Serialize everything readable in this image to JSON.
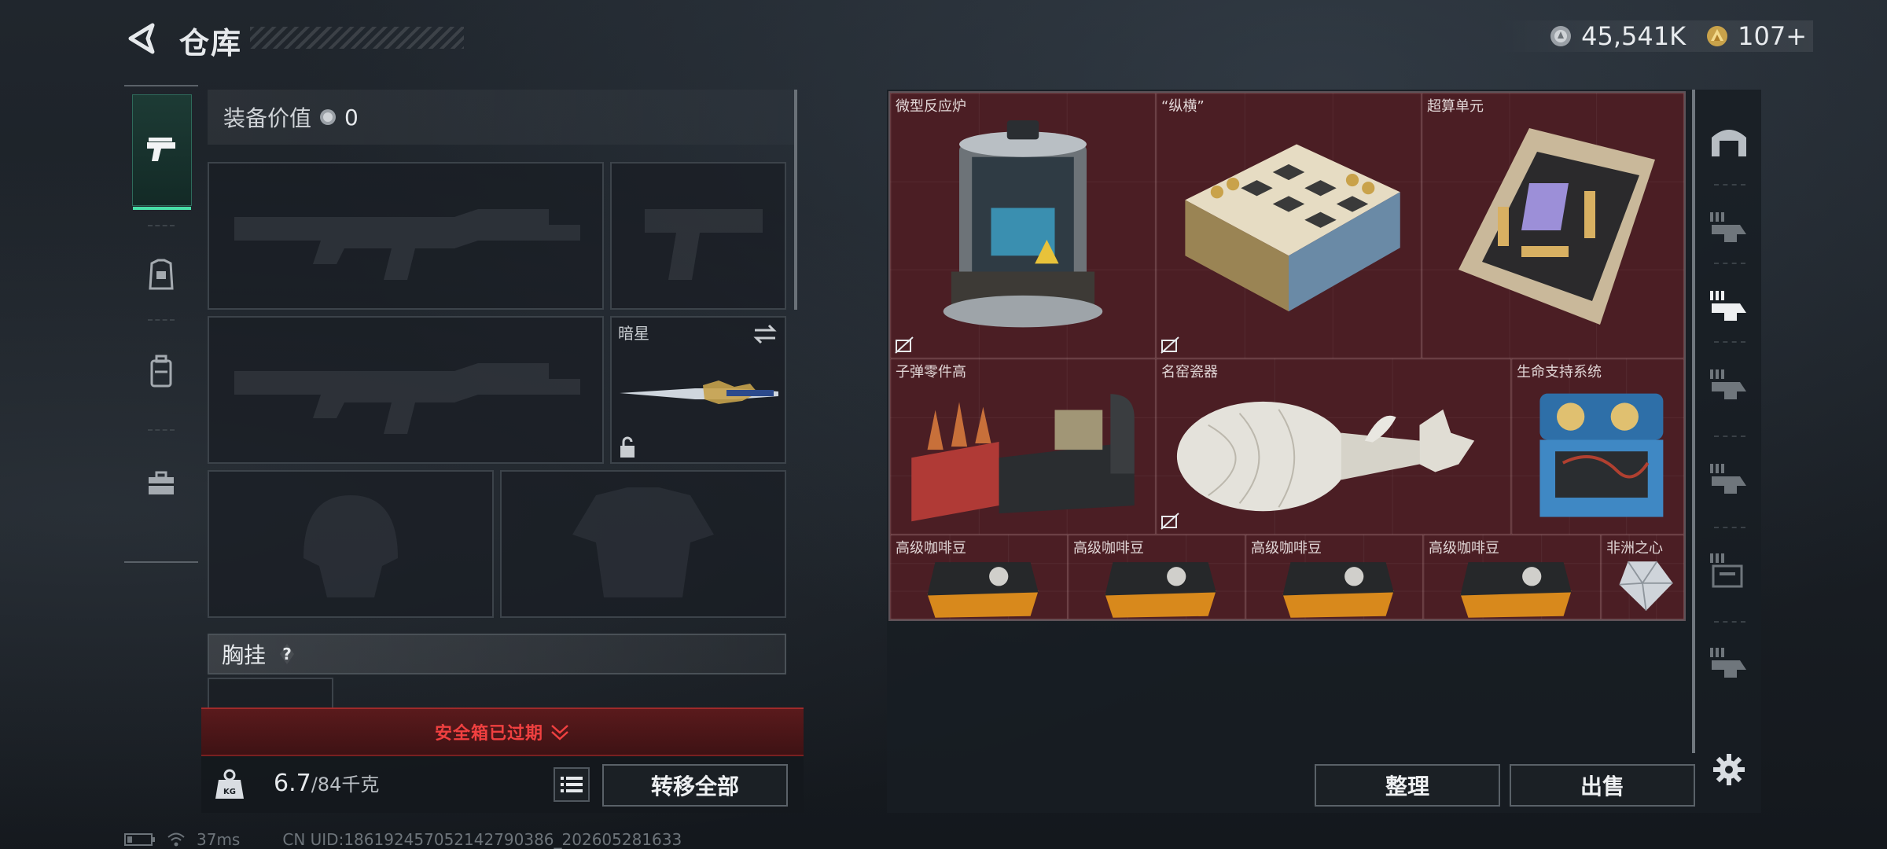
{
  "header": {
    "title": "仓库"
  },
  "currency": {
    "silver": "45,541K",
    "gold": "107+"
  },
  "nav": {
    "items": [
      "weapon-tab",
      "armor-tab",
      "backpack-tab",
      "case-tab"
    ]
  },
  "loadout": {
    "equip_label": "装备价值",
    "equip_value": "0",
    "melee_label": "暗星",
    "chest_label": "胸挂",
    "safe_box_status": "安全箱已过期",
    "weight_current": "6.7",
    "weight_max": "/84千克",
    "transfer_all": "转移全部"
  },
  "storage": {
    "items": [
      {
        "name": "微型反应炉"
      },
      {
        "name": "“纵横”"
      },
      {
        "name": "超算单元"
      },
      {
        "name": "子弹零件高"
      },
      {
        "name": "名窑瓷器"
      },
      {
        "name": "生命支持系统"
      },
      {
        "name": "高级咖啡豆"
      },
      {
        "name": "高级咖啡豆"
      },
      {
        "name": "高级咖啡豆"
      },
      {
        "name": "高级咖啡豆"
      },
      {
        "name": "非洲之心"
      }
    ],
    "sort_label": "整理",
    "sell_label": "出售"
  },
  "status": {
    "ping": "37ms",
    "uid": "CN UID:18619245705214279038​6_202605281633"
  },
  "colors": {
    "accent": "#48e0a8",
    "warning": "#f04040",
    "storage_bg": "#4b1e24"
  }
}
